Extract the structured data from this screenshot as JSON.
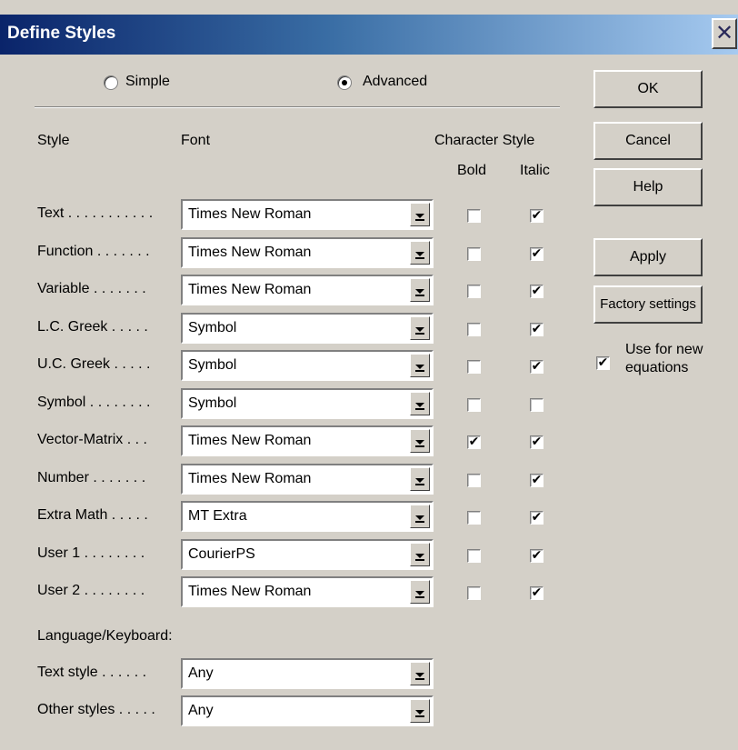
{
  "window": {
    "title": "Define Styles",
    "close_icon": "✕"
  },
  "mode": {
    "simple": "Simple",
    "advanced": "Advanced",
    "selected": "advanced"
  },
  "headers": {
    "style": "Style",
    "font": "Font",
    "character_style": "Character Style",
    "bold": "Bold",
    "italic": "Italic"
  },
  "styles": [
    {
      "label": "Text . . . . . . . . . . .",
      "font": "Times New Roman",
      "bold": false,
      "italic": true
    },
    {
      "label": "Function . . . . . . .",
      "font": "Times New Roman",
      "bold": false,
      "italic": true
    },
    {
      "label": "Variable . . . . . . .",
      "font": "Times New Roman",
      "bold": false,
      "italic": true
    },
    {
      "label": "L.C. Greek . . . . .",
      "font": "Symbol",
      "bold": false,
      "italic": true
    },
    {
      "label": "U.C. Greek . . . . .",
      "font": "Symbol",
      "bold": false,
      "italic": true
    },
    {
      "label": "Symbol . . . . . . . .",
      "font": "Symbol",
      "bold": false,
      "italic": false
    },
    {
      "label": "Vector-Matrix . . .",
      "font": "Times New Roman",
      "bold": true,
      "italic": true
    },
    {
      "label": "Number . . . . . . .",
      "font": "Times New Roman",
      "bold": false,
      "italic": true
    },
    {
      "label": "Extra Math . . . . .",
      "font": "MT Extra",
      "bold": false,
      "italic": true
    },
    {
      "label": "User 1 . . . . . . . .",
      "font": "CourierPS",
      "bold": false,
      "italic": true
    },
    {
      "label": "User 2 . . . . . . . .",
      "font": "Times New Roman",
      "bold": false,
      "italic": true
    }
  ],
  "language": {
    "heading": "Language/Keyboard:",
    "rows": [
      {
        "label": "Text style . . . . . .",
        "value": "Any"
      },
      {
        "label": "Other styles . . . . .",
        "value": "Any"
      }
    ]
  },
  "buttons": {
    "ok": "OK",
    "cancel": "Cancel",
    "help": "Help",
    "apply": "Apply",
    "factory": "Factory settings"
  },
  "use_for_new": {
    "line1": "Use for new",
    "line2": "equations",
    "checked": true
  },
  "check_glyph": "✔"
}
